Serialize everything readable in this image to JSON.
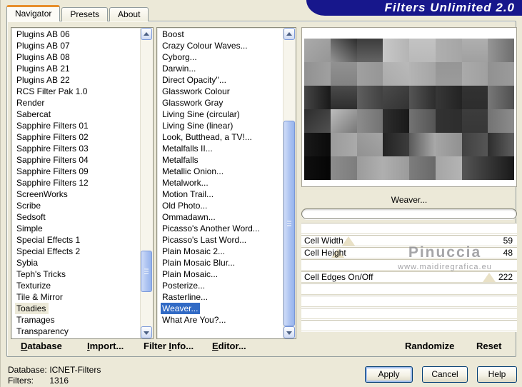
{
  "window": {
    "title": "Filters Unlimited 2.0"
  },
  "tabs": [
    {
      "label": "Navigator",
      "active": true
    },
    {
      "label": "Presets",
      "active": false
    },
    {
      "label": "About",
      "active": false
    }
  ],
  "category_list": {
    "selected": "Toadies",
    "items": [
      "Plugins AB 06",
      "Plugins AB 07",
      "Plugins AB 08",
      "Plugins AB 21",
      "Plugins AB 22",
      "RCS Filter Pak 1.0",
      "Render",
      "Sabercat",
      "Sapphire Filters 01",
      "Sapphire Filters 02",
      "Sapphire Filters 03",
      "Sapphire Filters 04",
      "Sapphire Filters 09",
      "Sapphire Filters 12",
      "ScreenWorks",
      "Scribe",
      "Sedsoft",
      "Simple",
      "Special Effects 1",
      "Special Effects 2",
      "Sybia",
      "Teph's Tricks",
      "Texturize",
      "Tile & Mirror",
      "Toadies",
      "Tramages",
      "Transparency"
    ]
  },
  "filter_list": {
    "selected": "Weaver...",
    "items": [
      "Boost",
      "Crazy Colour Waves...",
      "Cyborg...",
      "Darwin...",
      "Direct Opacity''...",
      "Glasswork Colour",
      "Glasswork Gray",
      "Living Sine (circular)",
      "Living Sine (linear)",
      "Look, Butthead, a TV!...",
      "Metalfalls II...",
      "Metalfalls",
      "Metallic Onion...",
      "Metalwork...",
      "Motion Trail...",
      "Old Photo...",
      "Ommadawn...",
      "Picasso's Another Word...",
      "Picasso's Last Word...",
      "Plain Mosaic 2...",
      "Plain Mosaic Blur...",
      "Plain Mosaic...",
      "Posterize...",
      "Rasterline...",
      "Weaver...",
      "What Are You?..."
    ]
  },
  "preview": {
    "cols": 8,
    "rows": 6,
    "cells": [
      [
        170,
        150,
        135
      ],
      [
        150,
        45,
        45
      ],
      [
        60,
        100,
        180
      ],
      [
        200,
        180,
        90
      ],
      [
        185,
        195,
        0
      ],
      [
        175,
        165,
        90
      ],
      [
        160,
        175,
        0
      ],
      [
        150,
        110,
        90
      ],
      [
        145,
        160,
        90
      ],
      [
        130,
        145,
        0
      ],
      [
        160,
        150,
        90
      ],
      [
        170,
        185,
        45
      ],
      [
        180,
        165,
        90
      ],
      [
        155,
        150,
        0
      ],
      [
        170,
        160,
        90
      ],
      [
        145,
        155,
        90
      ],
      [
        70,
        25,
        90
      ],
      [
        45,
        75,
        0
      ],
      [
        95,
        65,
        90
      ],
      [
        75,
        50,
        135
      ],
      [
        85,
        45,
        90
      ],
      [
        55,
        35,
        90
      ],
      [
        45,
        50,
        0
      ],
      [
        120,
        80,
        90
      ],
      [
        45,
        80,
        135
      ],
      [
        190,
        120,
        135
      ],
      [
        140,
        115,
        90
      ],
      [
        45,
        25,
        90
      ],
      [
        115,
        85,
        90
      ],
      [
        50,
        45,
        90
      ],
      [
        55,
        60,
        0
      ],
      [
        115,
        140,
        90
      ],
      [
        25,
        10,
        90
      ],
      [
        155,
        170,
        90
      ],
      [
        145,
        165,
        45
      ],
      [
        35,
        60,
        90
      ],
      [
        90,
        170,
        90
      ],
      [
        165,
        145,
        90
      ],
      [
        65,
        85,
        90
      ],
      [
        45,
        95,
        90
      ],
      [
        15,
        5,
        90
      ],
      [
        140,
        125,
        90
      ],
      [
        155,
        175,
        90
      ],
      [
        175,
        155,
        90
      ],
      [
        125,
        105,
        90
      ],
      [
        165,
        180,
        90
      ],
      [
        85,
        55,
        90
      ],
      [
        55,
        25,
        90
      ]
    ]
  },
  "controls": {
    "filter_name": "Weaver...",
    "sliders": [
      {
        "label": "",
        "value": "",
        "thumb": -1
      },
      {
        "label": "Cell Width",
        "value": "59",
        "thumb": 22
      },
      {
        "label": "Cell Height",
        "value": "48",
        "thumb": 17
      },
      {
        "label": "",
        "value": "",
        "thumb": -1
      },
      {
        "label": "Cell Edges On/Off",
        "value": "222",
        "thumb": 87
      },
      {
        "label": "",
        "value": "",
        "thumb": -1
      },
      {
        "label": "",
        "value": "",
        "thumb": -1
      },
      {
        "label": "",
        "value": "",
        "thumb": -1
      },
      {
        "label": "",
        "value": "",
        "thumb": -1
      }
    ],
    "randomize_label": "Randomize",
    "reset_label": "Reset"
  },
  "watermark": {
    "line1": "Pinuccia",
    "line2": "www.maidiregrafica.eu"
  },
  "commands": [
    {
      "pre": "",
      "u": "D",
      "post": "atabase"
    },
    {
      "pre": "",
      "u": "I",
      "post": "mport..."
    },
    {
      "pre": "Filter ",
      "u": "I",
      "post": "nfo..."
    },
    {
      "pre": "",
      "u": "E",
      "post": "ditor..."
    }
  ],
  "status": {
    "db_label": "Database:",
    "db_value": "ICNET-Filters",
    "filters_label": "Filters:",
    "filters_value": "1316"
  },
  "buttons": {
    "apply": "Apply",
    "cancel": "Cancel",
    "help": "Help"
  },
  "colors": {
    "selection": "#316AC5",
    "banner": "#17178C",
    "tab_accent": "#E78F2C"
  }
}
